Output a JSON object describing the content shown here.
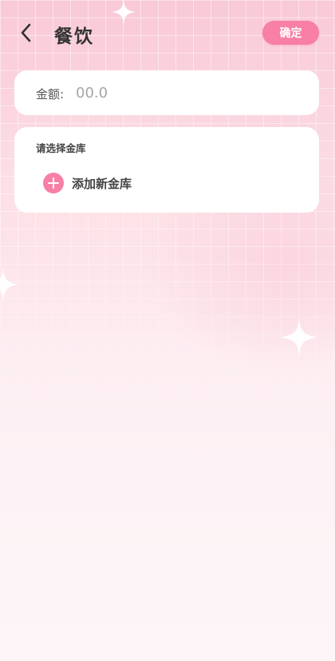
{
  "header": {
    "back_icon": "chevron-left-icon",
    "title": "餐饮",
    "confirm_label": "确定"
  },
  "amount": {
    "label": "金额:",
    "placeholder": "00.0",
    "value": ""
  },
  "vault": {
    "section_label": "请选择金库",
    "add_icon": "plus-circle-icon",
    "add_label": "添加新金库"
  },
  "colors": {
    "accent": "#f87fa5",
    "background_top": "#f9c9d7",
    "background_bottom": "#fdf5f8",
    "card": "#ffffff",
    "text_primary": "#333333",
    "placeholder": "#a6a6a6"
  }
}
